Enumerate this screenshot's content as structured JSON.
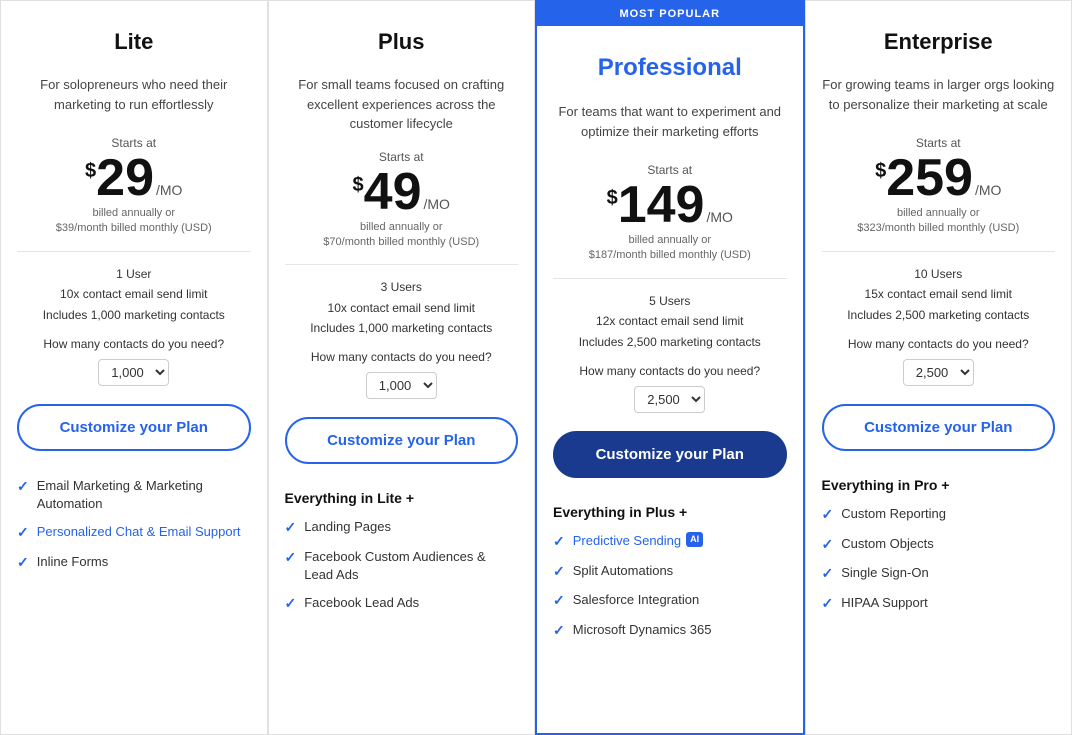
{
  "plans": [
    {
      "id": "lite",
      "name": "Lite",
      "popular": false,
      "description": "For solopreneurs who need their marketing to run effortlessly",
      "starts_at": "Starts at",
      "price": "29",
      "price_mo": "/MO",
      "billed_line1": "billed annually or",
      "billed_line2": "$39/month billed monthly (USD)",
      "limits": [
        "1 User",
        "10x contact email send limit",
        "Includes 1,000 marketing contacts"
      ],
      "contacts_question": "How many contacts do you need?",
      "contacts_default": "1,000",
      "cta": "Customize your Plan",
      "everything_in": null,
      "features": [
        {
          "text": "Email Marketing & Marketing Automation",
          "link": false
        },
        {
          "text": "Personalized Chat & Email Support",
          "link": true
        },
        {
          "text": "Inline Forms",
          "link": false
        }
      ]
    },
    {
      "id": "plus",
      "name": "Plus",
      "popular": false,
      "description": "For small teams focused on crafting excellent experiences across the customer lifecycle",
      "starts_at": "Starts at",
      "price": "49",
      "price_mo": "/MO",
      "billed_line1": "billed annually or",
      "billed_line2": "$70/month billed monthly (USD)",
      "limits": [
        "3 Users",
        "10x contact email send limit",
        "Includes 1,000 marketing contacts"
      ],
      "contacts_question": "How many contacts do you need?",
      "contacts_default": "1,000",
      "cta": "Customize your Plan",
      "everything_in": "Everything in Lite +",
      "features": [
        {
          "text": "Landing Pages",
          "link": false
        },
        {
          "text": "Facebook Custom Audiences & Lead Ads",
          "link": false
        },
        {
          "text": "Facebook Lead Ads",
          "link": false
        }
      ]
    },
    {
      "id": "professional",
      "name": "Professional",
      "popular": true,
      "most_popular_badge": "MOST POPULAR",
      "description": "For teams that want to experiment and optimize their marketing efforts",
      "starts_at": "Starts at",
      "price": "149",
      "price_mo": "/MO",
      "billed_line1": "billed annually or",
      "billed_line2": "$187/month billed monthly (USD)",
      "limits": [
        "5 Users",
        "12x contact email send limit",
        "Includes 2,500 marketing contacts"
      ],
      "contacts_question": "How many contacts do you need?",
      "contacts_default": "2,500",
      "cta": "Customize your Plan",
      "everything_in": "Everything in Plus +",
      "features": [
        {
          "text": "Predictive Sending",
          "link": true,
          "badge": "AI"
        },
        {
          "text": "Split Automations",
          "link": false
        },
        {
          "text": "Salesforce Integration",
          "link": false
        },
        {
          "text": "Microsoft Dynamics 365",
          "link": false
        }
      ]
    },
    {
      "id": "enterprise",
      "name": "Enterprise",
      "popular": false,
      "description": "For growing teams in larger orgs looking to personalize their marketing at scale",
      "starts_at": "Starts at",
      "price": "259",
      "price_mo": "/MO",
      "billed_line1": "billed annually or",
      "billed_line2": "$323/month billed monthly (USD)",
      "limits": [
        "10 Users",
        "15x contact email send limit",
        "Includes 2,500 marketing contacts"
      ],
      "contacts_question": "How many contacts do you need?",
      "contacts_default": "2,500",
      "cta": "Customize your Plan",
      "everything_in": "Everything in Pro +",
      "features": [
        {
          "text": "Custom Reporting",
          "link": false
        },
        {
          "text": "Custom Objects",
          "link": false
        },
        {
          "text": "Single Sign-On",
          "link": false
        },
        {
          "text": "HIPAA Support",
          "link": false
        }
      ]
    }
  ]
}
